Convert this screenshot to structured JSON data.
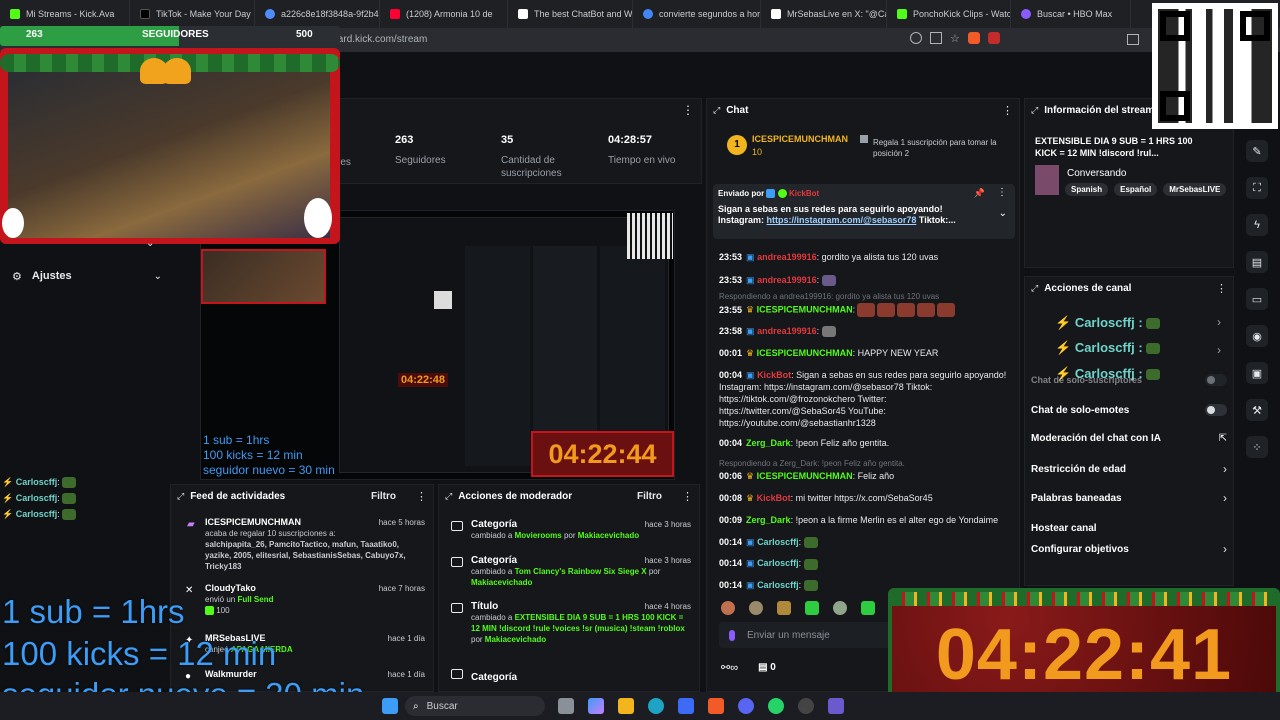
{
  "browser": {
    "tabs": [
      {
        "label": "Mi Streams - Kick.Ava",
        "color": "#53fc18"
      },
      {
        "label": "TikTok - Make Your Day",
        "color": "#111111"
      },
      {
        "label": "a226c8e18f3848a-9f2b42",
        "color": "#4f8cff"
      },
      {
        "label": "(1208) Armonia 10 de",
        "color": "#ff0033"
      },
      {
        "label": "The best ChatBot and Wid",
        "color": "#ffffff"
      },
      {
        "label": "convierte segundos a hora",
        "color": "#4285f4"
      },
      {
        "label": "MrSebasLive en X: \"@Car",
        "color": "#ffffff"
      },
      {
        "label": "PonchoKick Clips - Watch",
        "color": "#53fc18"
      },
      {
        "label": "Buscar • HBO Max",
        "color": "#8a5cff"
      }
    ],
    "url": "dashboard.kick.com/stream"
  },
  "follower_bar": {
    "current": "263",
    "label": "SEGUIDORES",
    "goal": "500",
    "progress": 0.526
  },
  "stats": [
    {
      "value": "263",
      "label": "Seguidores"
    },
    {
      "value": "35",
      "label": "Cantidad de suscripciones"
    },
    {
      "value": "04:28:57",
      "label": "Tiempo en vivo"
    }
  ],
  "stats_partial_label": "res",
  "sidebar": {
    "settings_label": "Ajustes"
  },
  "overlay": {
    "small_lines": [
      "1 sub = 1hrs",
      "100 kicks = 12 min",
      "seguidor nuevo = 30 min"
    ],
    "big_lines": [
      "1 sub = 1hrs",
      "100 kicks = 12 min",
      "seguidor nuevo = 30 min"
    ],
    "small_chat": [
      {
        "user": "Carloscffj",
        "sep": ":"
      },
      {
        "user": "Carloscffj",
        "sep": ":"
      },
      {
        "user": "Carloscffj",
        "sep": ":"
      }
    ],
    "timer_preview": "04:22:48",
    "timer_mid": "04:22:44",
    "timer_big": "04:22:41"
  },
  "activity_feed": {
    "title": "Feed de actividades",
    "filter": "Filtro",
    "items": [
      {
        "user": "ICESPICEMUNCHMAN",
        "time": "hace 5 horas",
        "text": "acaba de regalar 10 suscripciones a:",
        "detail": "salchipapita_26, PamcitoTactico, mafun, Taaatiko0, yazike, 2005, elitesrial, SebastianisSebas, Cabuyo7x, Tricky183"
      },
      {
        "user": "CloudyTako",
        "time": "hace 7 horas",
        "text": "envió un",
        "detail": "Full Send",
        "amount": "100"
      },
      {
        "user": "MRSebasLIVE",
        "time": "hace 1 día",
        "text": "canjeó",
        "detail": "APAGA MIERDA"
      },
      {
        "user": "Walkmurder",
        "time": "hace 1 día",
        "text": "",
        "detail": ""
      }
    ]
  },
  "mod_actions": {
    "title": "Acciones de moderador",
    "filter": "Filtro",
    "items": [
      {
        "type": "Categoría",
        "time": "hace 3 horas",
        "pre": "cambiado a",
        "value": "Movierooms",
        "by": "por",
        "user": "Makiacevichado"
      },
      {
        "type": "Categoría",
        "time": "hace 3 horas",
        "pre": "cambiado a",
        "value": "Tom Clancy's Rainbow Six Siege X",
        "by": "por",
        "user": "Makiacevichado"
      },
      {
        "type": "Título",
        "time": "hace 4 horas",
        "pre": "cambiado a",
        "value": "EXTENSIBLE DIA 9 SUB = 1 HRS 100 KICK = 12 MIN !discord !rule !voices !sr (musica) !steam !roblox !points !tienda",
        "by": "por",
        "user": "Makiacevichado"
      },
      {
        "type": "Categoría",
        "time": "hace 4 horas",
        "pre": "",
        "value": "",
        "by": "",
        "user": ""
      }
    ]
  },
  "chat": {
    "title": "Chat",
    "top_gifter": {
      "name": "ICESPICEMUNCHMAN",
      "count": "10",
      "rank": "1",
      "prompt": "Regala 1 suscripción para tomar la posición 2"
    },
    "pinned": {
      "sent_by": "Enviado por",
      "bot": "KickBot",
      "text": "Sigan a sebas en sus redes para seguirlo apoyando!",
      "line2_pre": "Instagram:",
      "link": "https://instagram.com/@sebasor78",
      "line2_post": "Tiktok:..."
    },
    "messages": [
      {
        "time": "23:53",
        "user": "andrea199916",
        "style": "red",
        "text": ": gordito ya alista tus 120 uvas"
      },
      {
        "time": "23:53",
        "user": "andrea199916",
        "style": "red",
        "text": ":"
      },
      {
        "reply": "Respondiendo a andrea199916: gordito ya alista tus 120 uvas"
      },
      {
        "time": "23:55",
        "user": "ICESPICEMUNCHMAN",
        "style": "green",
        "text": ":"
      },
      {
        "time": "23:58",
        "user": "andrea199916",
        "style": "red",
        "text": ":"
      },
      {
        "time": "00:01",
        "user": "ICESPICEMUNCHMAN",
        "style": "green",
        "text": ": HAPPY NEW YEAR"
      },
      {
        "time": "00:04",
        "user": "KickBot",
        "style": "red",
        "text": ": Sigan a sebas en sus redes para seguirlo apoyando! Instagram: https://instagram.com/@sebasor78 Tiktok: https://tiktok.com/@frozonokchero Twitter: https://twitter.com/@SebaSor45 YouTube: https://youtube.com/@sebastianhr1328"
      },
      {
        "time": "00:04",
        "user": "Zerg_Dark",
        "style": "green",
        "text": ": !peon Feliz año gentita."
      },
      {
        "reply": "Respondiendo a Zerg_Dark: !peon Feliz año gentita."
      },
      {
        "time": "00:06",
        "user": "ICESPICEMUNCHMAN",
        "style": "green",
        "text": ": Feliz año"
      },
      {
        "time": "00:08",
        "user": "KickBot",
        "style": "red",
        "text": ": mi twitter https://x.com/SebaSor45"
      },
      {
        "time": "00:09",
        "user": "Zerg_Dark",
        "style": "green",
        "text": ": !peon a la firme Merlin es el alter ego de Yondaime"
      },
      {
        "time": "00:14",
        "user": "Carloscffj",
        "style": "teal",
        "text": ":"
      },
      {
        "time": "00:14",
        "user": "Carloscffj",
        "style": "teal",
        "text": ":"
      },
      {
        "time": "00:14",
        "user": "Carloscffj",
        "style": "teal",
        "text": ":"
      }
    ],
    "input_placeholder": "Enviar un mensaje",
    "points": "0"
  },
  "stream_info": {
    "title": "Información del stream",
    "stream_title": "EXTENSIBLE DIA 9 SUB = 1 HRS 100 KICK = 12 MIN !discord !rul...",
    "category": "Conversando",
    "tags": [
      "Spanish",
      "Español",
      "MrSebasLIVE"
    ]
  },
  "channel_actions": {
    "title": "Acciones de canal",
    "overlay_users": [
      "Carloscffj",
      "Carloscffj",
      "Carloscffj"
    ],
    "items": [
      {
        "label": "Chat de solo-suscriptores",
        "control": "toggle"
      },
      {
        "label": "Chat de solo-emotes",
        "control": "toggle"
      },
      {
        "label": "Moderación del chat con IA",
        "control": "external"
      },
      {
        "label": "Restricción de edad",
        "control": "chevron"
      },
      {
        "label": "Palabras baneadas",
        "control": "chevron"
      },
      {
        "label": "Hostear canal",
        "control": "none"
      },
      {
        "label": "Configurar objetivos",
        "control": "chevron"
      }
    ]
  },
  "taskbar": {
    "search": "Buscar"
  },
  "colors": {
    "accent": "#53fc18",
    "overlay_blue": "#3d9df6",
    "timer_orange": "#f29a1d",
    "christmas_red": "#c4141c"
  }
}
